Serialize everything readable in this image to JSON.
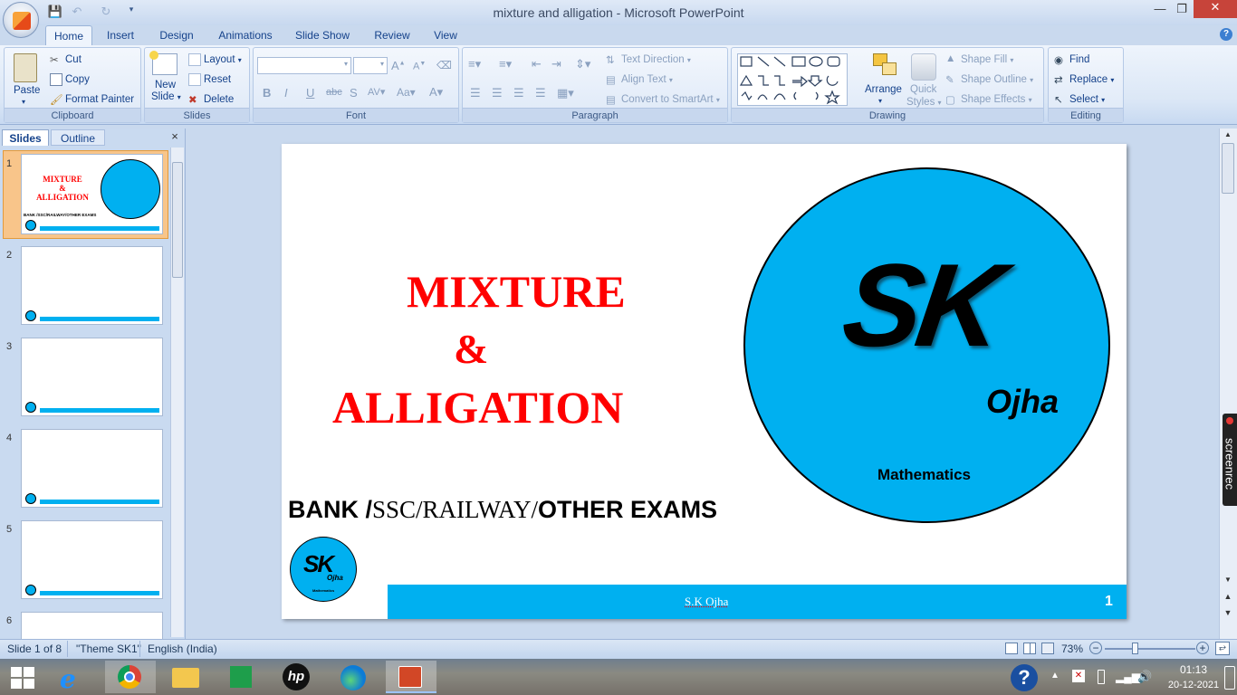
{
  "window": {
    "title": "mixture and alligation - Microsoft PowerPoint"
  },
  "tabs": [
    "Home",
    "Insert",
    "Design",
    "Animations",
    "Slide Show",
    "Review",
    "View"
  ],
  "ribbon": {
    "clipboard": {
      "label": "Clipboard",
      "paste": "Paste",
      "cut": "Cut",
      "copy": "Copy",
      "format_painter": "Format Painter"
    },
    "slides": {
      "label": "Slides",
      "new_slide_line1": "New",
      "new_slide_line2": "Slide",
      "layout": "Layout",
      "reset": "Reset",
      "delete": "Delete"
    },
    "font": {
      "label": "Font"
    },
    "paragraph": {
      "label": "Paragraph",
      "text_direction": "Text Direction",
      "align_text": "Align Text",
      "convert_smartart": "Convert to SmartArt"
    },
    "drawing": {
      "label": "Drawing",
      "arrange": "Arrange",
      "quick_styles_line1": "Quick",
      "quick_styles_line2": "Styles",
      "shape_fill": "Shape Fill",
      "shape_outline": "Shape Outline",
      "shape_effects": "Shape Effects"
    },
    "editing": {
      "label": "Editing",
      "find": "Find",
      "replace": "Replace",
      "select": "Select"
    }
  },
  "left_pane": {
    "tabs": [
      "Slides",
      "Outline"
    ],
    "close": "×",
    "slide_numbers": [
      "1",
      "2",
      "3",
      "4",
      "5",
      "6"
    ]
  },
  "slide": {
    "title_line1": "MIXTURE",
    "title_line2": "&",
    "title_line3": "ALLIGATION",
    "subtitle_bank": "BANK  /",
    "subtitle_mid": "SSC/RAILWAY/",
    "subtitle_end": "OTHER EXAMS",
    "logo_sk": "SK",
    "logo_ojha": "Ojha",
    "logo_mathematics": "Mathematics",
    "footer_name": "S.K Ojha",
    "footer_number": "1"
  },
  "thumb1": {
    "line1": "MIXTURE",
    "line2": "&",
    "line3": "ALLIGATION",
    "sub": "BANK  /SSC/RAILWAY/OTHER EXAMS"
  },
  "status": {
    "slide_info": "Slide 1 of 8",
    "theme": "\"Theme SK1\"",
    "language": "English (India)",
    "zoom": "73%"
  },
  "screenrec": {
    "label": "screenrec"
  },
  "tray": {
    "time": "01:13",
    "date": "20-12-2021"
  },
  "colors": {
    "title_red": "#ff0000",
    "logo_blue": "#00b0f0",
    "ribbon_text": "#15428b"
  }
}
